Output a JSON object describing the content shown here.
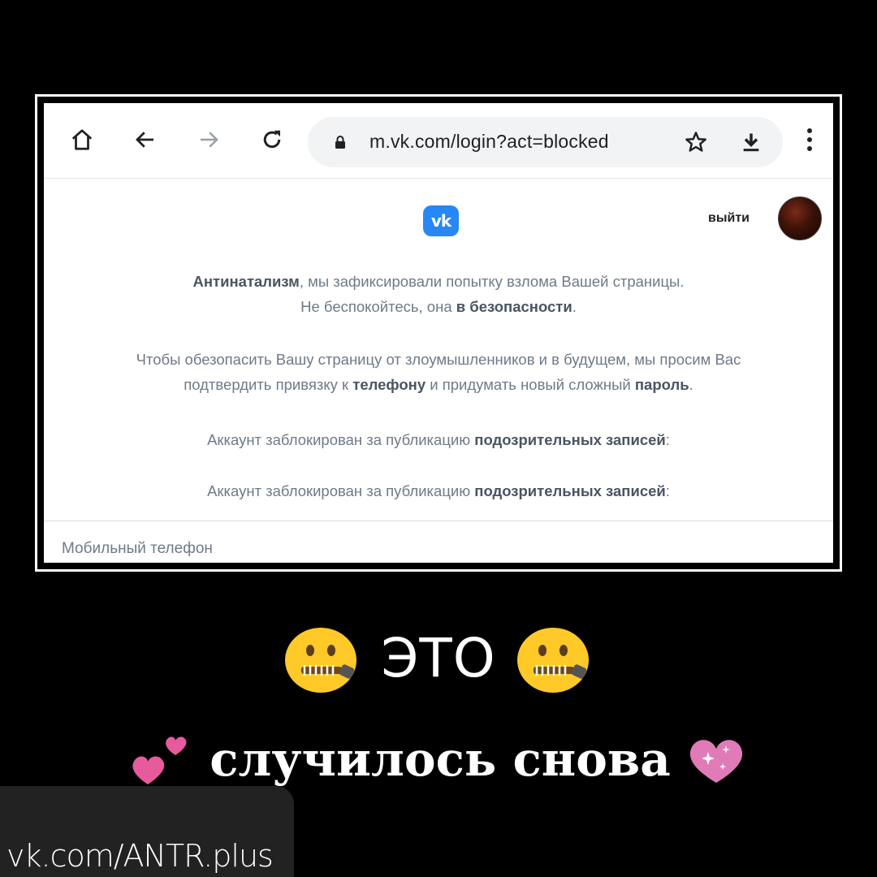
{
  "browser": {
    "url": "m.vk.com/login?act=blocked",
    "icons": [
      "home-icon",
      "back-icon",
      "forward-icon",
      "reload-icon",
      "lock-icon",
      "star-icon",
      "download-icon",
      "menu-icon"
    ]
  },
  "page": {
    "logo_text": "vk",
    "logout_label": "выйти",
    "paragraph1": {
      "name": "Антинатализм",
      "line1_rest": ", мы зафиксировали попытку взлома Вашей страницы.",
      "line2_start": "Не беспокойтесь, она ",
      "line2_bold": "в безопасности",
      "line2_end": "."
    },
    "paragraph2": {
      "line1": "Чтобы обезопасить Вашу страницу от злоумышленников и в будущем, мы просим Вас",
      "line2_start": "подтвердить привязку к ",
      "line2_bold1": "телефону",
      "line2_mid": " и придумать новый сложный ",
      "line2_bold2": "пароль",
      "line2_end": "."
    },
    "blocked_lines": [
      {
        "start": "Аккаунт заблокирован за публикацию ",
        "bold": "подозрительных записей",
        "end": ":"
      },
      {
        "start": "Аккаунт заблокирован за публикацию ",
        "bold": "подозрительных записей",
        "end": ":"
      }
    ],
    "phone_label": "Мобильный телефон"
  },
  "caption": {
    "word": "ЭТО",
    "subtitle": "случилось снова"
  },
  "watermark": "vk.com/ANTR.plus",
  "colors": {
    "vk_blue": "#2787f5",
    "text_gray": "#6f7a88",
    "emoji_yellow": "#ffc928",
    "heart_pink": "#e75a9c"
  }
}
